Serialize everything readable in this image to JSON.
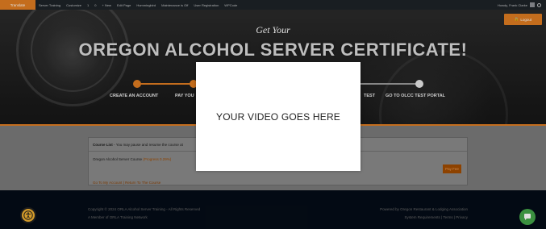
{
  "adminbar": {
    "translate": "Translate",
    "items": [
      "Server Training",
      "Customize",
      "1",
      "0",
      "+ New",
      "Edit Page",
      "Hummingbird",
      "Maintenance is Off",
      "User Registration",
      "WPCode"
    ],
    "howdy": "Howdy, Frank Clarke"
  },
  "hero": {
    "logout": "Logout",
    "subtitle": "Get Your",
    "title": "OREGON ALCOHOL SERVER CERTIFICATE!",
    "steps": [
      "CREATE AN ACCOUNT",
      "PAY YOU",
      "TEST",
      "GO TO OLCC TEST PORTAL"
    ],
    "progress_fraction": 0.2
  },
  "panel": {
    "header_title": "Course List",
    "header_note": "- You may pause and resume the course at",
    "course_name": "Oregon Alcohol Server Course",
    "course_progress": "(Progress 0.29%)",
    "pay_button": "Pay Fee",
    "link_account": "Go To My Account",
    "link_sep": " | ",
    "link_return": "Return To The Course"
  },
  "footer": {
    "copyright": "Copyright © 2024 ORLA Alcohol Server Training - All Rights Reserved",
    "member": "A Member of ORLA Training Network",
    "powered": "Powered by Oregon Restaurant & Lodging Association",
    "links": "System Requirements | Terms | Privacy"
  },
  "modal": {
    "text": "YOUR VIDEO GOES HERE"
  },
  "colors": {
    "accent": "#e07d21",
    "footer_bg": "#040c17",
    "chat": "#44a449",
    "accessibility": "#f0b030"
  },
  "icons": [
    "wordpress-icon",
    "comment-icon",
    "plus-icon",
    "edit-icon",
    "lock-icon",
    "accessibility-icon",
    "chat-icon",
    "search-icon",
    "avatar"
  ]
}
